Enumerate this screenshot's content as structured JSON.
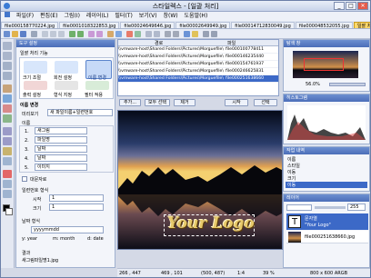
{
  "app": {
    "title": "스타일렉스 - [일괄 처리]"
  },
  "menu": [
    "파일(F)",
    "편집(E)",
    "그림(I)",
    "레이어(L)",
    "필터(T)",
    "보기(V)",
    "창(W)",
    "도움말(H)"
  ],
  "tabs": [
    {
      "label": "file000158770224.jpg"
    },
    {
      "label": "file0001018322853.jpg"
    },
    {
      "label": "file00024649646.jpg"
    },
    {
      "label": "file00002649949.jpg"
    },
    {
      "label": "file00014712830049.jpg"
    },
    {
      "label": "file000048532055.jpg"
    },
    {
      "label": "일괄 처리",
      "active": true
    }
  ],
  "left_panel": {
    "header": "도구 설정",
    "batch_label": "일괄 처리 기능",
    "functions": [
      "크기 조절",
      "회전 설정",
      "이름 변경",
      "출력 설정",
      "형식 지정",
      "필터 적용"
    ],
    "selected_function": "이름 변경",
    "rename_section": "이름 변경",
    "preview_label": "미리보기",
    "preview_value": "새 파일이름+일련번호",
    "name_section": "이름",
    "name_fields": [
      {
        "index": "1.",
        "value": "새그림"
      },
      {
        "index": "2.",
        "value": "파일명"
      },
      {
        "index": "3.",
        "value": "날짜"
      },
      {
        "index": "4.",
        "value": "날짜"
      },
      {
        "index": "5.",
        "value": "이미지"
      }
    ],
    "ext_upper_label": "대문자로",
    "serial_section": "일련번호 형식",
    "serial_start_label": "시작",
    "serial_start_value": "1",
    "serial_size_label": "크기",
    "serial_size_value": "1",
    "date_section": "날짜 형식",
    "date_value": "yyyymmdd",
    "date_hints": [
      "y: year",
      "m: month",
      "d: date"
    ],
    "result_label": "결과",
    "result_value": "새그림파일명1.jpg"
  },
  "file_list": {
    "header_path": "경로",
    "header_file": "파일",
    "rows": [
      {
        "path": "\\\\vmware-host\\Shared Folders\\Pictures\\Morguefile\\",
        "file": "file000100778411"
      },
      {
        "path": "\\\\vmware-host\\Shared Folders\\Pictures\\Morguefile\\",
        "file": "file000146235440"
      },
      {
        "path": "\\\\vmware-host\\Shared Folders\\Pictures\\Morguefile\\",
        "file": "file000154761937"
      },
      {
        "path": "\\\\vmware-host\\Shared Folders\\Pictures\\Morguefile\\",
        "file": "file000246625831"
      },
      {
        "path": "\\\\vmware-host\\Shared Folders\\Pictures\\Morguefile\\",
        "file": "file000251638660",
        "selected": true
      },
      {
        "path": "",
        "file": ""
      }
    ],
    "buttons": [
      "추가...",
      "모두 선택",
      "제거",
      "시작",
      "선택"
    ]
  },
  "preview": {
    "caption": "Your Logo"
  },
  "right_panels": {
    "nav_header": "탐색 창",
    "zoom": "56.0%",
    "histogram_header": "히스토그램",
    "history_header": "작업 내역",
    "history_items": [
      "이름",
      "스타일",
      "이동",
      "크기",
      "이동"
    ],
    "layers_header": "레이어",
    "opacity": "255",
    "layers": [
      {
        "name": "문자열",
        "sub": "\"Your Logo\""
      },
      {
        "name": "file000251638660.jpg",
        "sub": ""
      }
    ]
  },
  "status": {
    "coords": "266 , 447",
    "pos": "469 , 101",
    "size": "(500, 487)",
    "zoom": "1:4",
    "ratio": "39 %",
    "dims": "800 x 600 ARGB"
  }
}
